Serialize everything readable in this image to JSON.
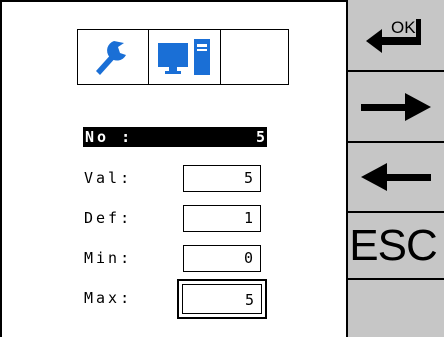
{
  "toolbar": {
    "tabs": [
      {
        "icon": "wrench-icon"
      },
      {
        "icon": "computer-icon"
      },
      {
        "icon": "empty"
      }
    ]
  },
  "param": {
    "no_label": "No :",
    "no_value": "5",
    "fields": [
      {
        "label": "Val:",
        "value": "5"
      },
      {
        "label": "Def:",
        "value": "1"
      },
      {
        "label": "Min:",
        "value": "0"
      },
      {
        "label": "Max:",
        "value": "5"
      }
    ]
  },
  "side_buttons": {
    "ok_label": "OK",
    "esc_label": "ESC"
  },
  "colors": {
    "icon_blue": "#1a6fd6",
    "panel_gray": "#c6c6c6"
  }
}
